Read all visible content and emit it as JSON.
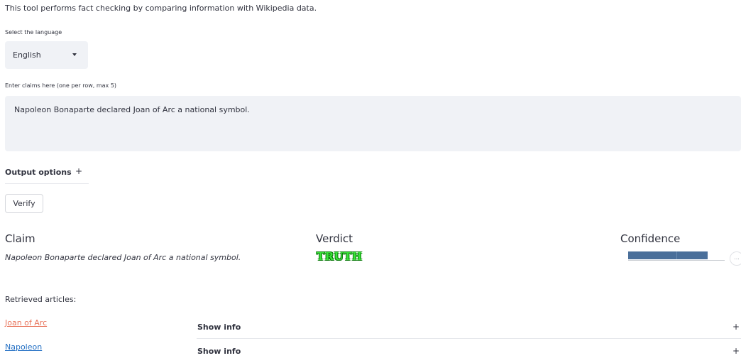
{
  "intro": "This tool performs fact checking by comparing information with Wikipedia data.",
  "language": {
    "label": "Select the language",
    "selected": "English"
  },
  "claims": {
    "label": "Enter claims here (one per row, max 5)",
    "value": "Napoleon Bonaparte declared Joan of Arc a national symbol."
  },
  "output_options": {
    "label": "Output options",
    "icon": "+"
  },
  "verify_button": "Verify",
  "results": {
    "headers": {
      "claim": "Claim",
      "verdict": "Verdict",
      "confidence": "Confidence"
    },
    "rows": [
      {
        "claim": "Napoleon Bonaparte declared Joan of Arc a national symbol.",
        "verdict": "TRUTH",
        "confidence": 0.82
      }
    ],
    "more_icon": "..."
  },
  "retrieved": {
    "label": "Retrieved articles:",
    "articles": [
      {
        "title": "Joan of Arc",
        "info_label": "Show info",
        "icon": "+",
        "color": "#e8735a"
      },
      {
        "title": "Napoleon",
        "info_label": "Show info",
        "icon": "+",
        "color": "#2470c4"
      }
    ]
  },
  "colors": {
    "accent_fill": "#4a6f9a",
    "truth_green": "#3ae23a",
    "field_bg": "#f0f2f6"
  }
}
